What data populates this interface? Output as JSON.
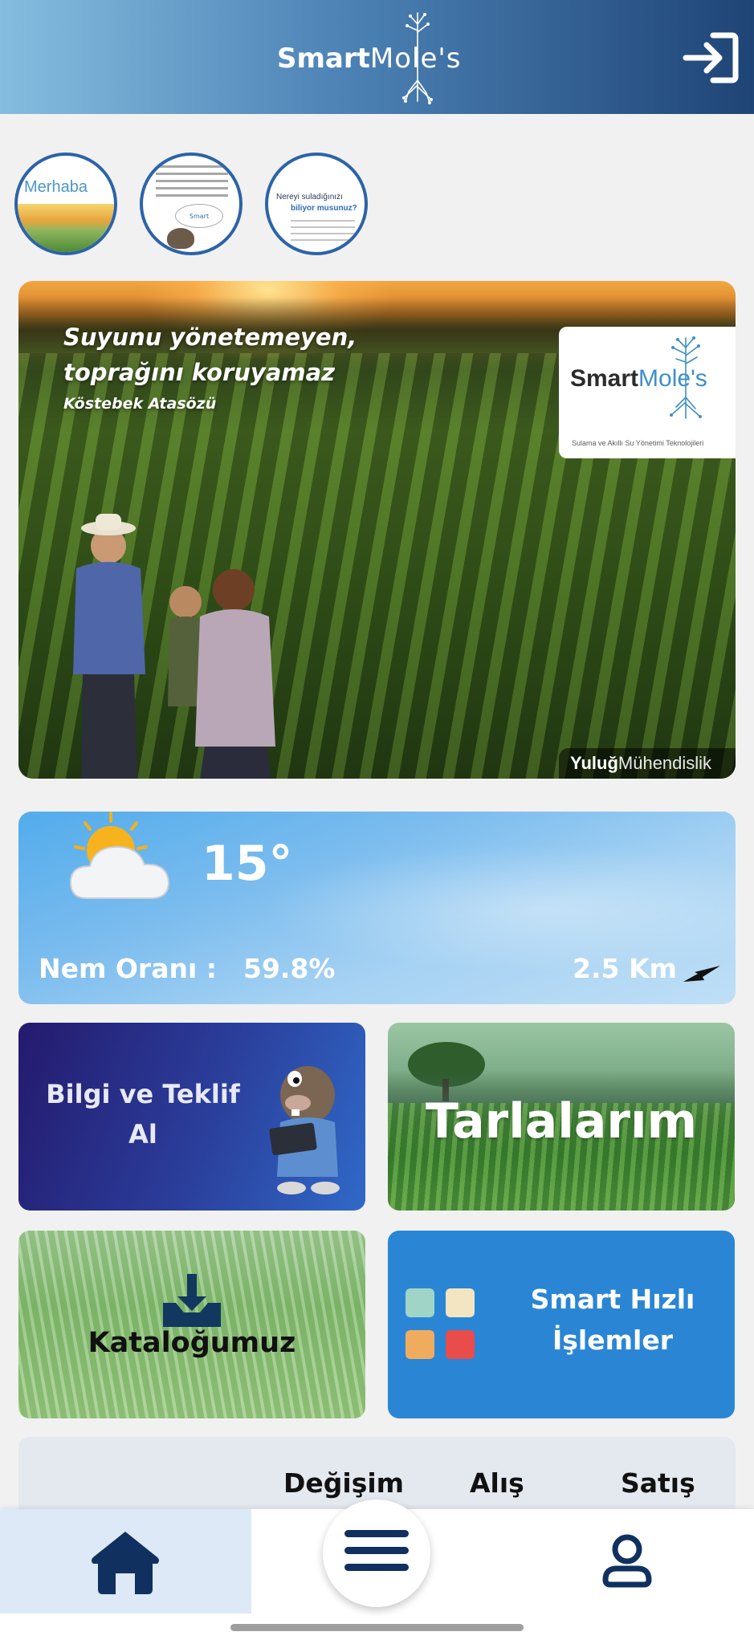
{
  "header": {
    "logo_smart": "Smart",
    "logo_moles": "Mole's",
    "logout_icon": "logout-icon"
  },
  "stories": [
    {
      "title": "Merhaba"
    },
    {
      "title": "Smart"
    },
    {
      "title_line1": "Nereyi suladığınızı",
      "title_line2": "biliyor musunuz?"
    }
  ],
  "hero": {
    "title": "Suyunu yönetemeyen, toprağını koruyamaz",
    "subtitle": "Köstebek Atasözü",
    "card_smart": "Smart",
    "card_moles": "Mole's",
    "card_tagline": "Sulama ve Akıllı Su Yönetimi Teknolojileri",
    "brand_bold": "Yuluğ",
    "brand_rest": "Mühendislik"
  },
  "weather": {
    "temperature": "15°",
    "humidity_label": "Nem Oranı :",
    "humidity_value": "59.8%",
    "wind_distance": "2.5 Km",
    "icon": "partly-cloudy-icon"
  },
  "tiles": {
    "info": "Bilgi ve Teklif Al",
    "fields": "Tarlalarım",
    "catalog": "Kataloğumuz",
    "smart": "Smart Hızlı İşlemler"
  },
  "exchange": {
    "col_change": "Değişim",
    "col_buy": "Alış",
    "col_sell": "Satış"
  },
  "nav": {
    "home_icon": "home-icon",
    "menu_icon": "menu-icon",
    "profile_icon": "profile-icon"
  },
  "colors": {
    "header_start": "#84bddf",
    "header_end": "#1f4476",
    "nav_icon": "#10315f",
    "smart_tile": "#2a86d5"
  }
}
